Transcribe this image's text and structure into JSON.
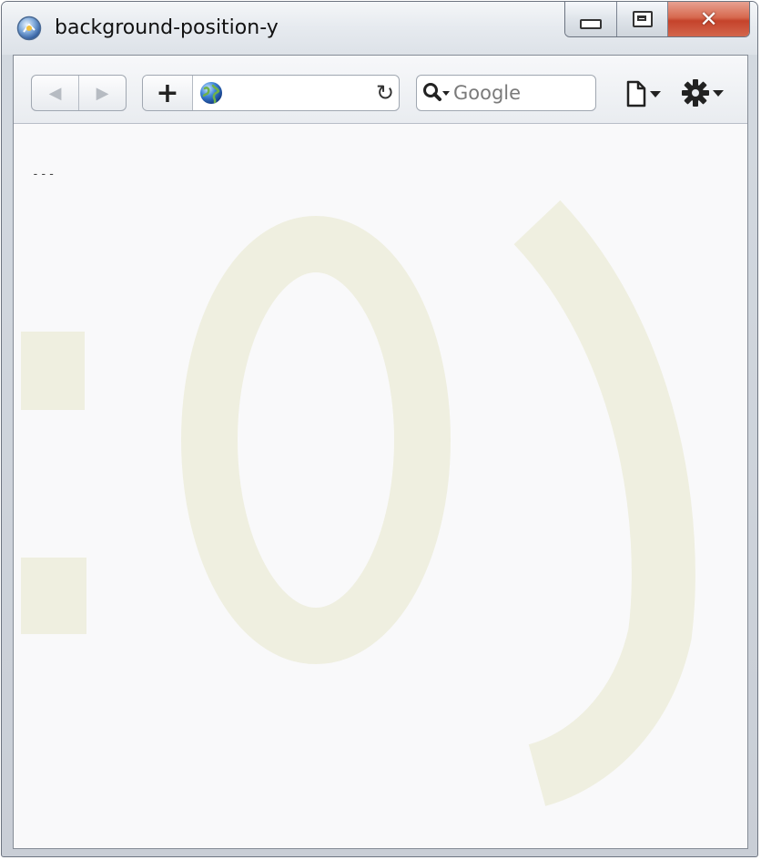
{
  "window": {
    "title": "background-position-y"
  },
  "toolbar": {
    "back_label": "◀",
    "forward_label": "▶",
    "add_label": "+",
    "address_value": "",
    "reload_label": "↻",
    "search_placeholder": "Google"
  },
  "content": {
    "text": "---",
    "background_glyphs": ":0)",
    "glyph_color": "#efefe0"
  },
  "colors": {
    "close_button": "#c5432b",
    "page_background": "#f9f9fa"
  }
}
